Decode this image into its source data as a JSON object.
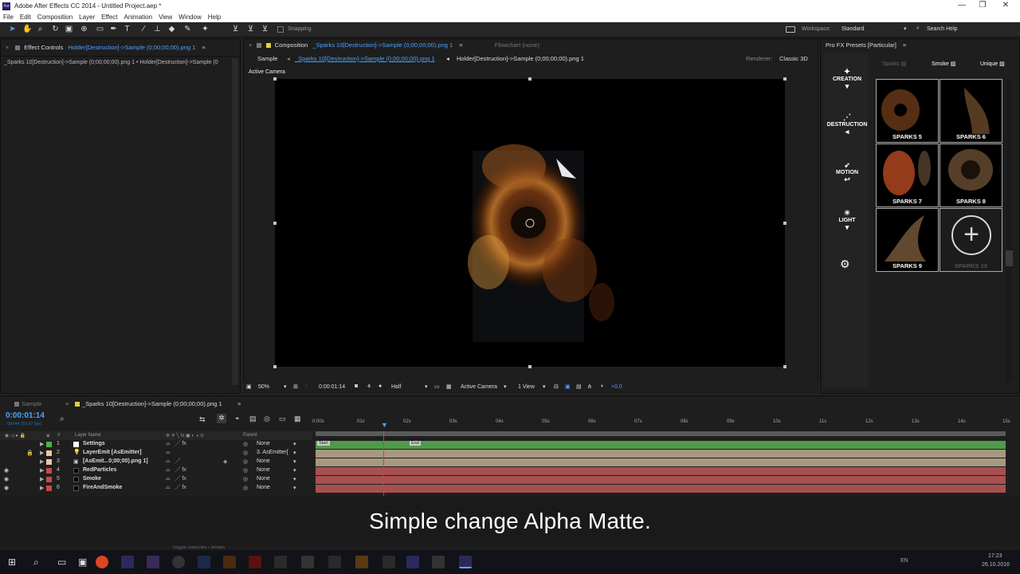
{
  "window": {
    "title": "Adobe After Effects CC 2014 - Untitled Project.aep *",
    "logo": "Ae"
  },
  "menu": [
    "File",
    "Edit",
    "Composition",
    "Layer",
    "Effect",
    "Animation",
    "View",
    "Window",
    "Help"
  ],
  "toolbar": {
    "snapping_label": "Snapping",
    "workspace_label": "Workspace:",
    "workspace_value": "Standard",
    "search_help": "Search Help"
  },
  "effect_controls": {
    "tab": "Effect Controls",
    "tab_target": "Holder[Destruction]->Sample (0;00;00;00).png 1",
    "path": "_Sparks 10[Destruction]->Sample (0;00;00;00).png 1 • Holder[Destruction]->Sample (0"
  },
  "composition": {
    "tab_prefix": "Composition",
    "tab_name": "_Sparks 10[Destruction]->Sample (0;00;00;00).png 1",
    "flowchart": "Flowchart (none)",
    "crumbs": [
      "Sample",
      "_Sparks 10[Destruction]->Sample (0;00;00;00).png 1",
      "Holder[Destruction]->Sample (0;00;00;00).png 1"
    ],
    "renderer_label": "Renderer:",
    "renderer_value": "Classic 3D",
    "active_camera": "Active Camera",
    "footer": {
      "zoom": "50%",
      "time": "0:00:01:14",
      "resolution": "Half",
      "camera": "Active Camera",
      "views": "1 View",
      "exposure": "+0.0"
    }
  },
  "fx_presets": {
    "tab": "Pro FX Presets [Particular]",
    "categories": [
      "Sparks",
      "Smoke",
      "Unique"
    ],
    "side": [
      "CREATION",
      "DESTRUCTION",
      "MOTION",
      "LIGHT"
    ],
    "presets": [
      "SPARKS 5",
      "SPARKS 6",
      "SPARKS 7",
      "SPARKS 8",
      "SPARKS 9",
      "SPARKS 10"
    ]
  },
  "timeline": {
    "tabs": [
      "Sample",
      "_Sparks 10[Destruction]->Sample (0;00;00;00).png 1"
    ],
    "timecode": "0:00:01:14",
    "frame_info": "00044 (29.97 fps)",
    "col_num": "#",
    "col_layer": "Layer Name",
    "col_parent": "Parent",
    "ruler": [
      "0:00s",
      "01s",
      "02s",
      "03s",
      "04s",
      "05s",
      "06s",
      "07s",
      "08s",
      "09s",
      "10s",
      "11s",
      "12s",
      "13s",
      "14s",
      "15s"
    ],
    "layers": [
      {
        "num": "1",
        "name": "Settings",
        "parent": "None",
        "color": "#4fb04a"
      },
      {
        "num": "2",
        "name": "LayerEmit [AsEmitter]",
        "parent": "3. AsEmitter[",
        "color": "#e8c8a0"
      },
      {
        "num": "3",
        "name": "[AsEmit...0;00;00).png 1]",
        "parent": "None",
        "color": "#e8c8a0"
      },
      {
        "num": "4",
        "name": "RedParticles",
        "parent": "None",
        "color": "#c84848"
      },
      {
        "num": "5",
        "name": "Smoke",
        "parent": "None",
        "color": "#c84848"
      },
      {
        "num": "6",
        "name": "FireAndSmoke",
        "parent": "None",
        "color": "#c84848"
      }
    ],
    "markers": [
      "Start",
      "End"
    ],
    "toggle_label": "Toggle Switches / Modes"
  },
  "subtitle": "Simple change Alpha Matte.",
  "tray": {
    "lang": "EN",
    "time": "17:23",
    "date": "26.10.2016"
  }
}
